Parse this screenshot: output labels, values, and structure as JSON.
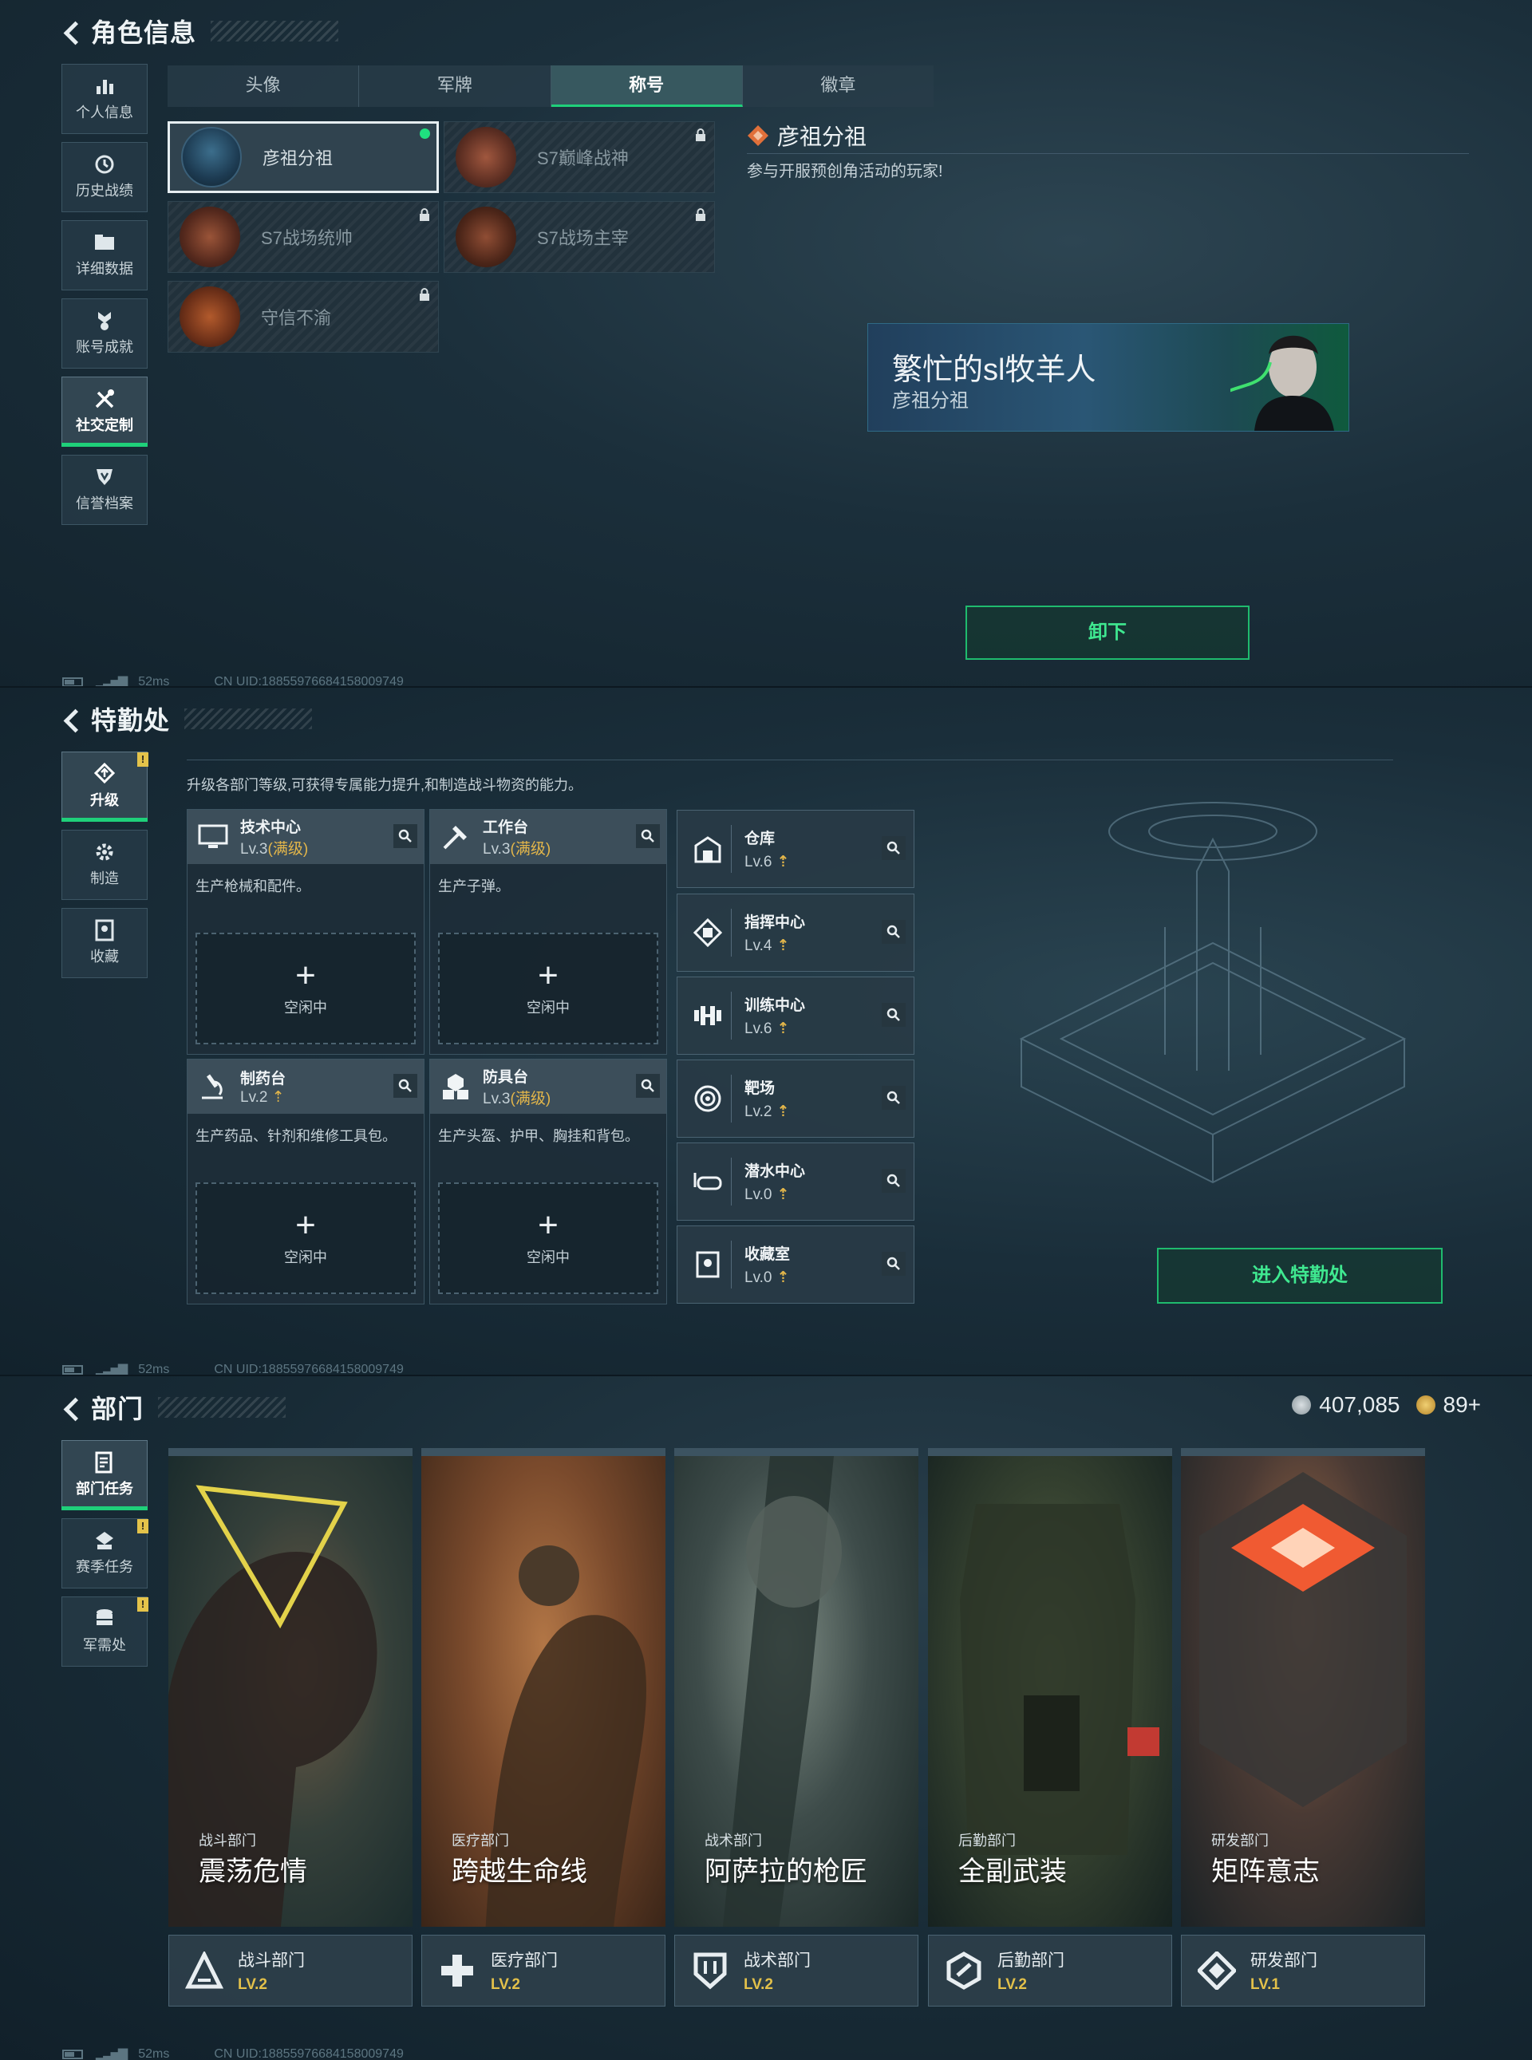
{
  "panel1": {
    "title": "角色信息",
    "sidebar": [
      {
        "label": "个人信息",
        "icon": "bar-chart-icon"
      },
      {
        "label": "历史战绩",
        "icon": "clock-icon"
      },
      {
        "label": "详细数据",
        "icon": "folder-icon"
      },
      {
        "label": "账号成就",
        "icon": "medal-icon"
      },
      {
        "label": "社交定制",
        "icon": "tools-icon",
        "active": true
      },
      {
        "label": "信誉档案",
        "icon": "shield-icon"
      }
    ],
    "tabs": [
      "头像",
      "军牌",
      "称号",
      "徽章"
    ],
    "active_tab": "称号",
    "titles": [
      {
        "name": "彦祖分祖",
        "locked": false,
        "equipped": true
      },
      {
        "name": "S7巅峰战神",
        "locked": true
      },
      {
        "name": "S7战场统帅",
        "locked": true
      },
      {
        "name": "S7战场主宰",
        "locked": true
      },
      {
        "name": "守信不渝",
        "locked": true
      }
    ],
    "detail": {
      "name": "彦祖分祖",
      "desc": "参与开服预创角活动的玩家!",
      "banner_line1": "繁忙的sl牧羊人",
      "banner_line2": "彦祖分祖"
    },
    "unload_button": "卸下",
    "footer": {
      "ping": "52ms",
      "uid": "CN UID:18855976684158009749"
    }
  },
  "panel2": {
    "title": "特勤处",
    "sidebar": [
      {
        "label": "升级",
        "icon": "upgrade-icon",
        "active": true,
        "badge": "!"
      },
      {
        "label": "制造",
        "icon": "gear-icon"
      },
      {
        "label": "收藏",
        "icon": "collection-icon"
      }
    ],
    "desc": "升级各部门等级,可获得专属能力提升,和制造战斗物资的能力。",
    "facilities": [
      {
        "name": "技术中心",
        "level": "Lv.3",
        "max": "(满级)",
        "desc": "生产枪械和配件。",
        "slot": "空闲中",
        "icon": "monitor-icon"
      },
      {
        "name": "工作台",
        "level": "Lv.3",
        "max": "(满级)",
        "desc": "生产子弹。",
        "slot": "空闲中",
        "icon": "hammer-icon"
      },
      {
        "name": "制药台",
        "level": "Lv.2",
        "max": "",
        "desc": "生产药品、针剂和维修工具包。",
        "slot": "空闲中",
        "icon": "microscope-icon"
      },
      {
        "name": "防具台",
        "level": "Lv.3",
        "max": "(满级)",
        "desc": "生产头盔、护甲、胸挂和背包。",
        "slot": "空闲中",
        "icon": "armor-icon"
      }
    ],
    "small": [
      {
        "name": "仓库",
        "level": "Lv.6",
        "icon": "warehouse-icon"
      },
      {
        "name": "指挥中心",
        "level": "Lv.4",
        "icon": "command-icon"
      },
      {
        "name": "训练中心",
        "level": "Lv.6",
        "icon": "dumbbell-icon"
      },
      {
        "name": "靶场",
        "level": "Lv.2",
        "icon": "target-icon"
      },
      {
        "name": "潜水中心",
        "level": "Lv.0",
        "icon": "goggles-icon"
      },
      {
        "name": "收藏室",
        "level": "Lv.0",
        "icon": "vault-icon"
      }
    ],
    "enter_button": "进入特勤处",
    "footer": {
      "ping": "52ms",
      "uid": "CN UID:18855976684158009749"
    }
  },
  "panel3": {
    "title": "部门",
    "sidebar": [
      {
        "label": "部门任务",
        "icon": "task-icon",
        "active": true
      },
      {
        "label": "赛季任务",
        "icon": "season-icon",
        "badge": "!"
      },
      {
        "label": "军需处",
        "icon": "supply-icon",
        "badge": "!"
      }
    ],
    "currency": {
      "coins": "407,085",
      "tickets": "89+"
    },
    "departments": [
      {
        "category": "战斗部门",
        "name": "震荡危情",
        "bar_name": "战斗部门",
        "level": "LV.2",
        "tone": "#2e5a55",
        "icon": "combat-icon"
      },
      {
        "category": "医疗部门",
        "name": "跨越生命线",
        "bar_name": "医疗部门",
        "level": "LV.2",
        "tone": "#a2603a",
        "icon": "medic-icon"
      },
      {
        "category": "战术部门",
        "name": "阿萨拉的枪匠",
        "bar_name": "战术部门",
        "level": "LV.2",
        "tone": "#3b4a4a",
        "icon": "tactic-icon"
      },
      {
        "category": "后勤部门",
        "name": "全副武装",
        "bar_name": "后勤部门",
        "level": "LV.2",
        "tone": "#3f4c3a",
        "icon": "logistics-icon"
      },
      {
        "category": "研发部门",
        "name": "矩阵意志",
        "bar_name": "研发部门",
        "level": "LV.1",
        "tone": "#4b3b35",
        "icon": "research-icon"
      }
    ],
    "footer": {
      "ping": "52ms",
      "uid": "CN UID:18855976684158009749"
    }
  }
}
